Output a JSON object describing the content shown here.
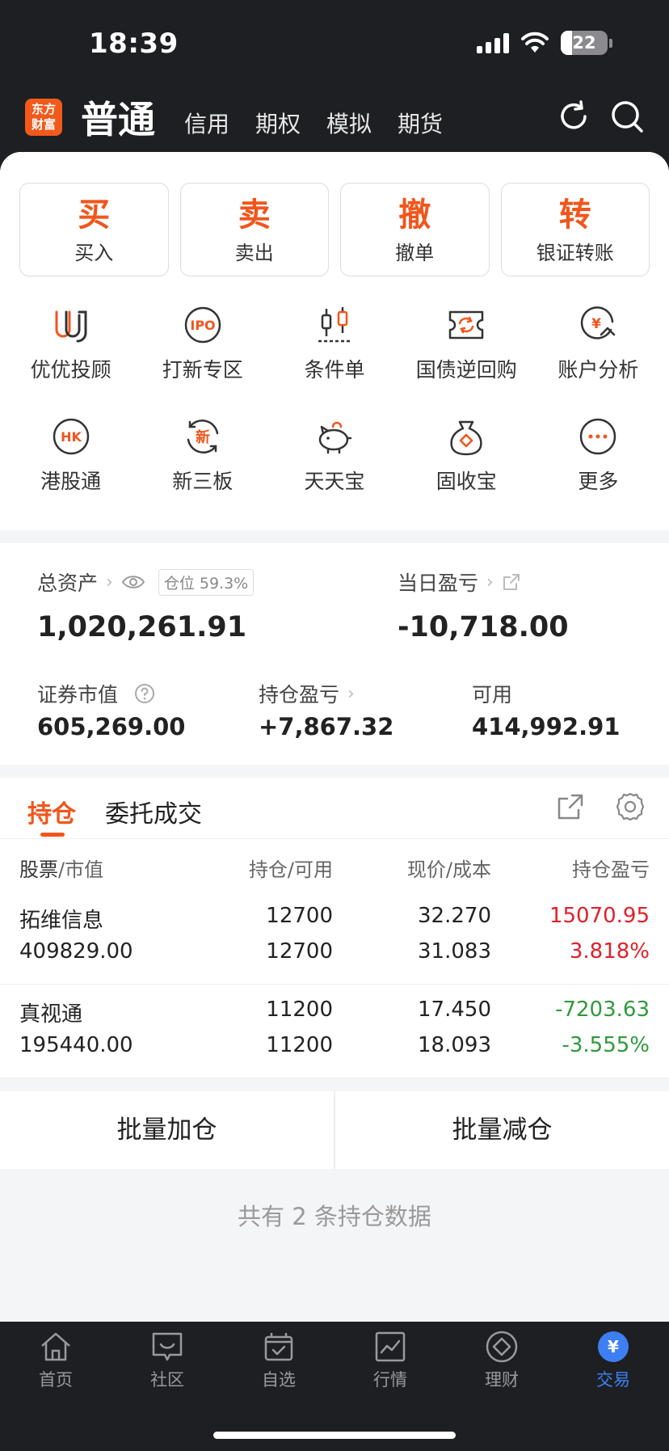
{
  "status": {
    "time": "18:39",
    "battery": "22"
  },
  "header": {
    "logo_line1": "东方",
    "logo_line2": "财富",
    "active_tab": "普通",
    "tabs": [
      "信用",
      "期权",
      "模拟",
      "期货"
    ]
  },
  "quick_actions": [
    {
      "big": "买",
      "label": "买入"
    },
    {
      "big": "卖",
      "label": "卖出"
    },
    {
      "big": "撤",
      "label": "撤单"
    },
    {
      "big": "转",
      "label": "银证转账"
    }
  ],
  "features": [
    {
      "label": "优优投顾",
      "icon": "uu-advisor-icon"
    },
    {
      "label": "打新专区",
      "icon": "ipo-icon",
      "icon_text": "IPO"
    },
    {
      "label": "条件单",
      "icon": "candlestick-icon"
    },
    {
      "label": "国债逆回购",
      "icon": "repo-icon"
    },
    {
      "label": "账户分析",
      "icon": "account-analysis-icon",
      "icon_text": "¥"
    },
    {
      "label": "港股通",
      "icon": "hk-icon",
      "icon_text": "HK"
    },
    {
      "label": "新三板",
      "icon": "new-third-board-icon",
      "icon_text": "新"
    },
    {
      "label": "天天宝",
      "icon": "piggy-bank-icon"
    },
    {
      "label": "固收宝",
      "icon": "money-bag-icon"
    },
    {
      "label": "更多",
      "icon": "more-icon"
    }
  ],
  "assets": {
    "total_label": "总资产",
    "position_badge": "仓位 59.3%",
    "total_value": "1,020,261.91",
    "daily_pl_label": "当日盈亏",
    "daily_pl_value": "-10,718.00",
    "market_value_label": "证券市值",
    "market_value": "605,269.00",
    "holding_pl_label": "持仓盈亏",
    "holding_pl_value": "+7,867.32",
    "available_label": "可用",
    "available_value": "414,992.91"
  },
  "holdings": {
    "tab_active": "持仓",
    "tab_other": "委托成交",
    "col_stock": "股票",
    "col_stock_sub": "/市值",
    "col_qty": "持仓",
    "col_qty_sub": "/可用",
    "col_price": "现价",
    "col_price_sub": "/成本",
    "col_pl": "持仓盈亏",
    "rows": [
      {
        "name": "拓维信息",
        "market_value": "409829.00",
        "qty": "12700",
        "available": "12700",
        "price": "32.270",
        "cost": "31.083",
        "pl": "15070.95",
        "pl_pct": "3.818%",
        "positive": true
      },
      {
        "name": "真视通",
        "market_value": "195440.00",
        "qty": "11200",
        "available": "11200",
        "price": "17.450",
        "cost": "18.093",
        "pl": "-7203.63",
        "pl_pct": "-3.555%",
        "positive": false
      }
    ],
    "batch_add": "批量加仓",
    "batch_reduce": "批量减仓",
    "count_text": "共有 2 条持仓数据"
  },
  "nav": [
    {
      "label": "首页",
      "icon": "home-icon"
    },
    {
      "label": "社区",
      "icon": "community-icon"
    },
    {
      "label": "自选",
      "icon": "watchlist-icon"
    },
    {
      "label": "行情",
      "icon": "market-icon"
    },
    {
      "label": "理财",
      "icon": "wealth-icon"
    },
    {
      "label": "交易",
      "icon": "trade-icon",
      "icon_text": "¥",
      "active": true
    }
  ],
  "colors": {
    "accent": "#f0561c",
    "up": "#e0202a",
    "down": "#2f9a3a",
    "nav_active": "#3d7ff2"
  }
}
